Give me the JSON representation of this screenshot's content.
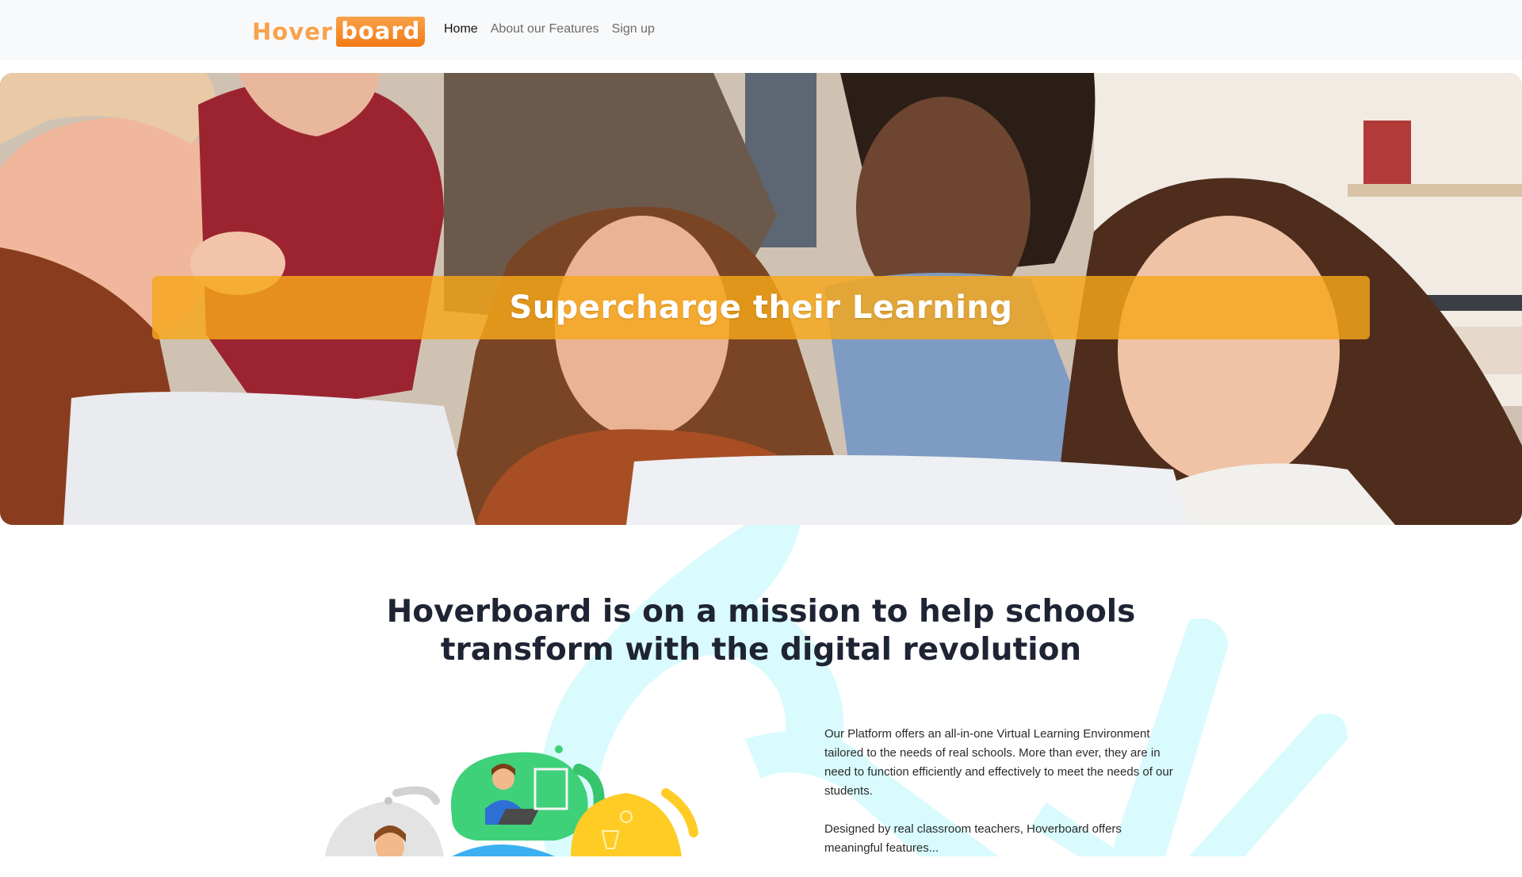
{
  "brand": {
    "logo_part1": "Hover",
    "logo_part2": "board",
    "accent": "#f7a24c",
    "accent_dark": "#f07a16"
  },
  "nav": {
    "items": [
      {
        "label": "Home",
        "active": true
      },
      {
        "label": "About our Features",
        "active": false
      },
      {
        "label": "Sign up",
        "active": false
      }
    ]
  },
  "hero": {
    "title": "Supercharge their Learning",
    "banner_color": "#f7a71a"
  },
  "mission": {
    "title_line1": "Hoverboard is on a mission to help schools",
    "title_line2": "transform with the digital revolution",
    "paragraph1": "Our Platform offers an all-in-one Virtual Learning Environment tailored to the needs of real schools. More than ever, they are in need to function efficiently and effectively to meet the needs of our students.",
    "paragraph2": "Designed by real classroom teachers, Hoverboard offers meaningful features..."
  },
  "colors": {
    "navbar_bg": "#f8f9fa",
    "deco_cyan": "#d9fbfd",
    "heading": "#1e2433"
  }
}
